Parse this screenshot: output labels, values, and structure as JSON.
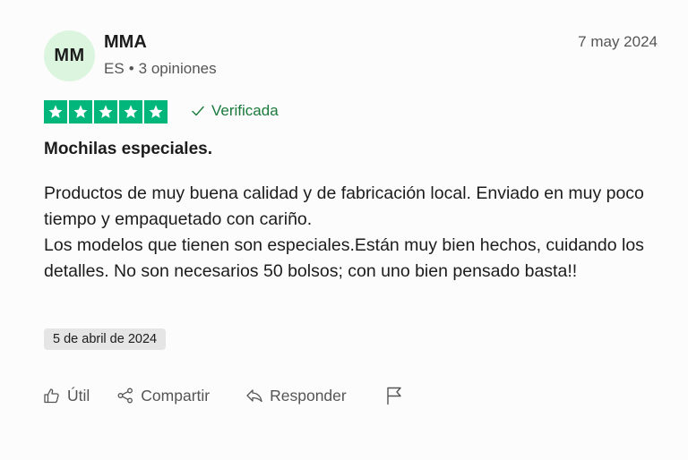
{
  "reviewer": {
    "initials": "MM",
    "name": "MMA",
    "country": "ES",
    "separator": "•",
    "review_count": "3 opiniones"
  },
  "review": {
    "date": "7 may 2024",
    "rating": 5,
    "star_color": "#00b67a",
    "verified_label": "Verificada",
    "verified_icon": "check-icon",
    "title": "Mochilas especiales.",
    "paragraphs": [
      "Productos de muy buena calidad y de fabricación local. Enviado en muy poco tiempo y empaquetado con cariño.",
      "Los modelos que tienen son especiales.Están muy bien hechos, cuidando los detalles. No son necesarios 50 bolsos; con uno bien pensado basta!!"
    ],
    "experience_date": "5 de abril de 2024"
  },
  "actions": {
    "useful_label": "Útil",
    "useful_icon": "thumbs-up-icon",
    "share_label": "Compartir",
    "share_icon": "share-icon",
    "reply_label": "Responder",
    "reply_icon": "reply-icon",
    "report_icon": "flag-icon"
  }
}
